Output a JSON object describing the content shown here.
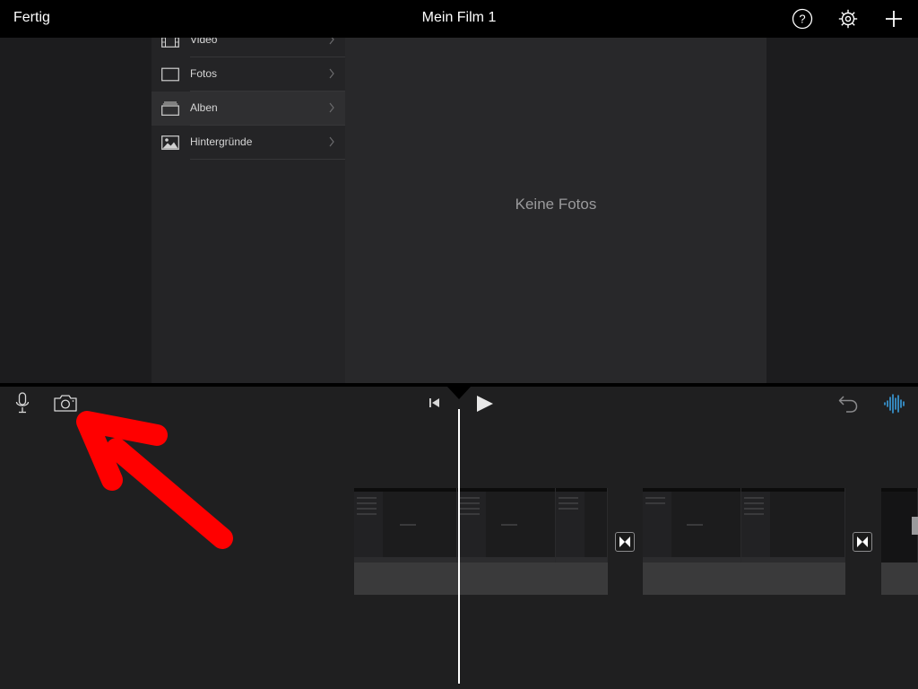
{
  "topbar": {
    "done_label": "Fertig",
    "title": "Mein Film 1",
    "icons": [
      "help-icon",
      "settings-gear-icon",
      "plus-icon"
    ]
  },
  "media_browser": {
    "categories": [
      {
        "label": "Video",
        "icon": "film-icon",
        "selected": false
      },
      {
        "label": "Fotos",
        "icon": "photo-frame-icon",
        "selected": false
      },
      {
        "label": "Alben",
        "icon": "album-stack-icon",
        "selected": true
      },
      {
        "label": "Hintergründe",
        "icon": "landscape-image-icon",
        "selected": false
      }
    ],
    "empty_message": "Keine Fotos"
  },
  "toolbar": {
    "left_icons": [
      "microphone-icon",
      "camera-icon"
    ],
    "center_icons": [
      "skip-to-start-icon",
      "play-icon"
    ],
    "right_icons": [
      "undo-icon",
      "audio-waveform-icon"
    ]
  },
  "timeline": {
    "clips": 3,
    "transitions": 2
  },
  "colors": {
    "accent": "#3a9fe0",
    "annotation_arrow": "#ff0000",
    "background": "#1f1f20",
    "topbar": "#000000"
  }
}
